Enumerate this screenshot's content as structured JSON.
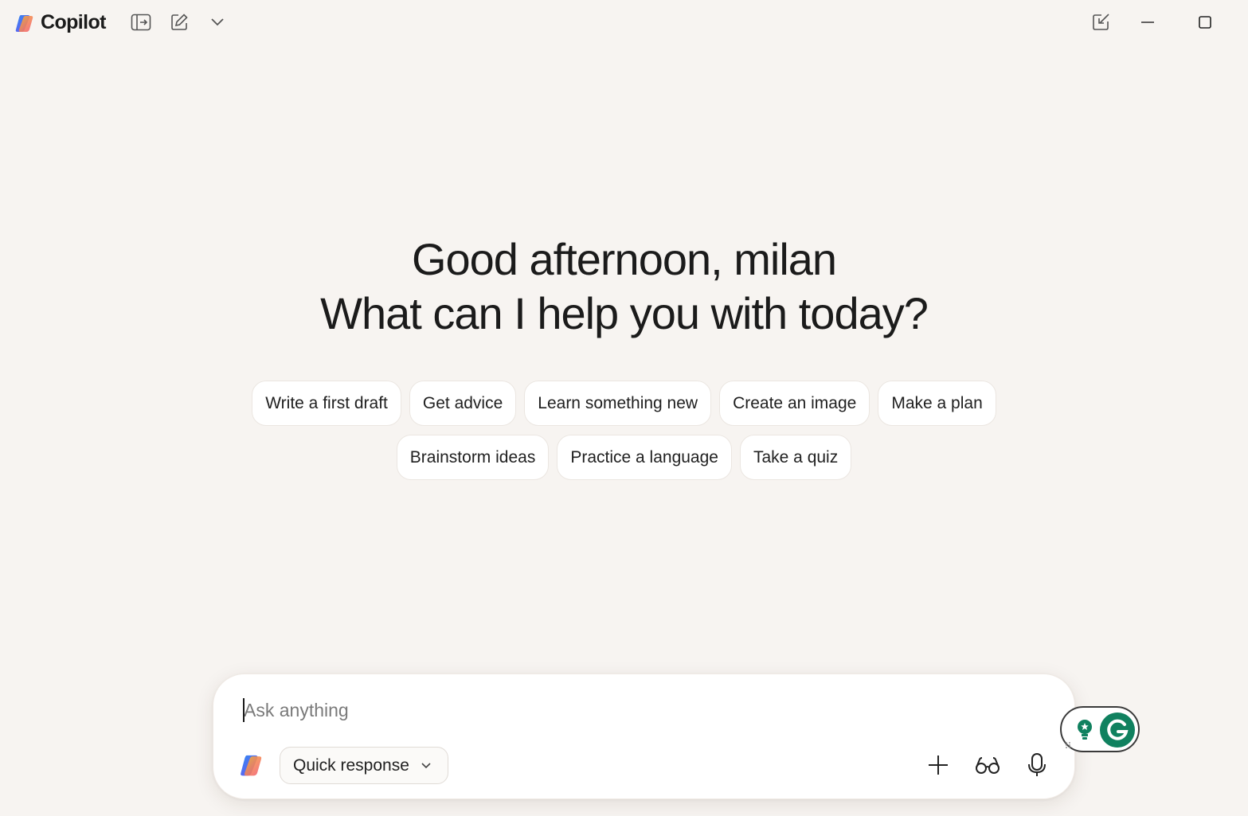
{
  "app": {
    "name": "Copilot"
  },
  "titlebar": {
    "icons": [
      "sidebar-toggle-icon",
      "new-chat-icon",
      "chevron-down-icon",
      "compact-mode-icon",
      "minimize-icon",
      "maximize-icon"
    ]
  },
  "greeting": {
    "line1": "Good afternoon, milan",
    "line2": "What can I help you with today?"
  },
  "suggestions": {
    "row1": [
      "Write a first draft",
      "Get advice",
      "Learn something new",
      "Create an image",
      "Make a plan"
    ],
    "row2": [
      "Brainstorm ideas",
      "Practice a language",
      "Take a quiz"
    ]
  },
  "composer": {
    "placeholder": "Ask anything",
    "value": "",
    "mode_label": "Quick response",
    "actions": [
      "add-icon",
      "vision-icon",
      "microphone-icon"
    ]
  },
  "colors": {
    "background": "#f7f4f1",
    "chip_background": "#ffffff",
    "grammarly_green": "#10815f"
  }
}
